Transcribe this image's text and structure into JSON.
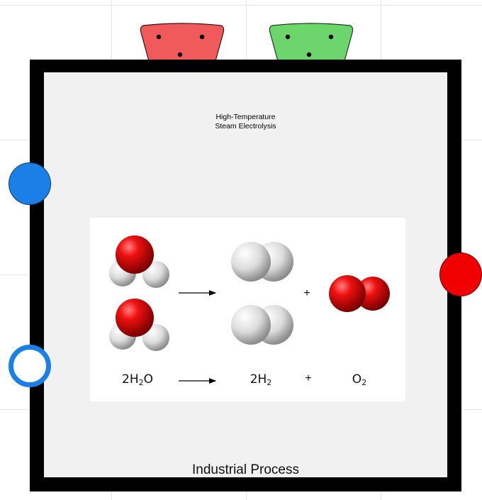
{
  "title": {
    "line1": "High-Temperature",
    "line2": "Steam Electrolysis"
  },
  "footer_label": "Industrial Process",
  "equation": {
    "reactant": "2H",
    "reactant_sub": "2",
    "reactant_tail": "O",
    "product1": "2H",
    "product1_sub": "2",
    "product2": "O",
    "product2_sub": "2",
    "plus": "+"
  },
  "colors": {
    "frame": "#000000",
    "panel": "#f1f1f1",
    "input_port": "#1a7fe6",
    "output_port": "#f00000",
    "connector_red": "#f05a5a",
    "connector_green": "#6cd66c"
  }
}
